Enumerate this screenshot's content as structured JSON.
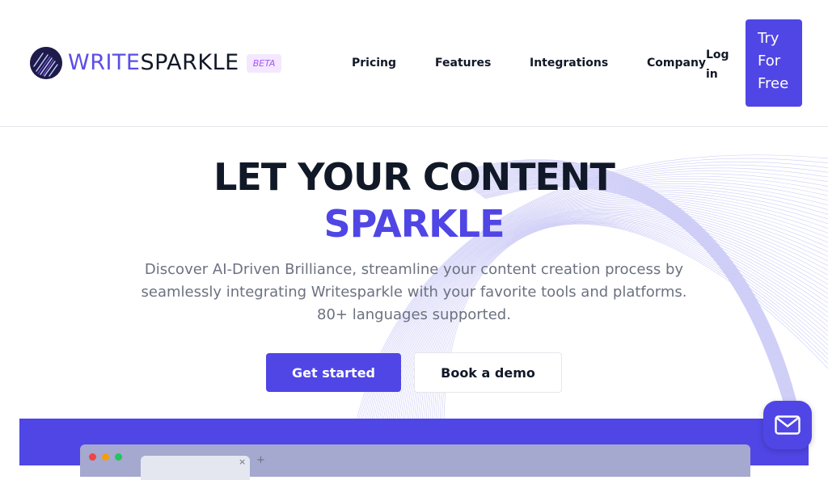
{
  "brand": {
    "name_part1": "WRITE",
    "name_part2": "SPARKLE",
    "badge": "BETA"
  },
  "nav": {
    "items": [
      {
        "label": "Pricing"
      },
      {
        "label": "Features"
      },
      {
        "label": "Integrations"
      },
      {
        "label": "Company"
      }
    ],
    "login": "Log in",
    "cta": "Try For Free"
  },
  "hero": {
    "title_line1": "LET YOUR CONTENT",
    "title_line2": "SPARKLE",
    "subtitle": "Discover AI-Driven Brilliance, streamline your content creation process by seamlessly integrating Writesparkle with your favorite tools and platforms. 80+ languages supported.",
    "primary_button": "Get started",
    "secondary_button": "Book a demo"
  },
  "preview": {
    "tab_close": "×",
    "tab_add": "+"
  },
  "colors": {
    "accent": "#5046e5",
    "dark": "#111827",
    "muted": "#6b7280",
    "badge_bg": "#f3e8ff",
    "badge_text": "#a855f7"
  },
  "icons": {
    "logo": "sparkle-logo-icon",
    "chat": "mail-icon"
  }
}
